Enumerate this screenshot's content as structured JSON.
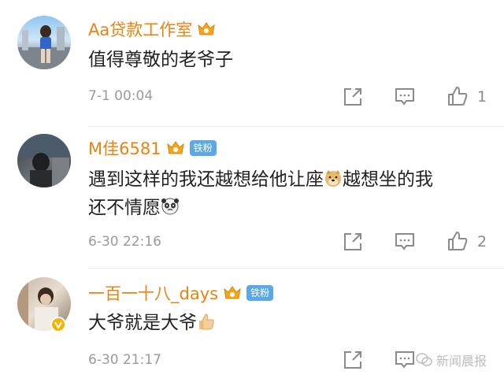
{
  "comments": [
    {
      "username": "Aa贷款工作室",
      "text": "值得尊敬的老爷子",
      "timestamp": "7-1 00:04",
      "like_count": "1",
      "badge": ""
    },
    {
      "username": "M佳6581",
      "text_part1": "遇到这样的我还越想给他让座",
      "text_part2": "越想坐的我",
      "text_line2": "还不情愿",
      "timestamp": "6-30 22:16",
      "like_count": "2",
      "badge": "铁粉"
    },
    {
      "username": "一百一十八_days",
      "text": "大爷就是大爷",
      "timestamp": "6-30 21:17",
      "like_count": "",
      "badge": "铁粉"
    }
  ],
  "watermark": "新闻晨报",
  "colors": {
    "name": "#e8840f",
    "badge_bg": "#5aa9e6",
    "meta": "#9a9a9a"
  },
  "icons": [
    "crown-icon",
    "share-icon",
    "comment-icon",
    "like-icon",
    "doge-emoji",
    "panda-emoji",
    "thumbs-up-emoji",
    "wechat-icon"
  ]
}
